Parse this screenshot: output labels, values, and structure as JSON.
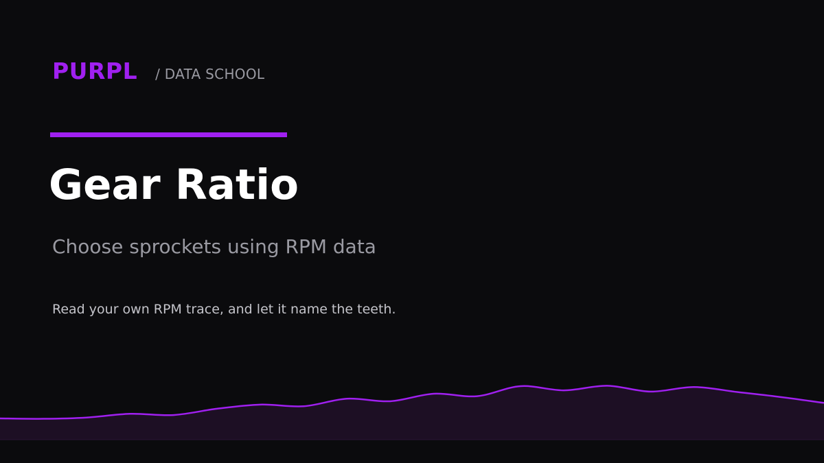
{
  "brand": {
    "name": "PURPL",
    "section": "/ DATA SCHOOL"
  },
  "slide": {
    "title": "Gear Ratio",
    "subtitle": "Choose sprockets using RPM data",
    "tagline": "Read your own RPM trace, and let it name the teeth."
  },
  "colors": {
    "background": "#0b0b0d",
    "accent": "#a020f0",
    "title": "#ffffff",
    "muted": "#9a9aa2",
    "body": "#c4c4ca",
    "trace_fill": "#1d0f24"
  },
  "decoration": {
    "rpm_trace_relative": [
      0.05,
      0.04,
      0.07,
      0.16,
      0.13,
      0.28,
      0.38,
      0.34,
      0.52,
      0.46,
      0.64,
      0.58,
      0.82,
      0.72,
      0.83,
      0.69,
      0.8,
      0.68,
      0.56,
      0.42
    ]
  }
}
